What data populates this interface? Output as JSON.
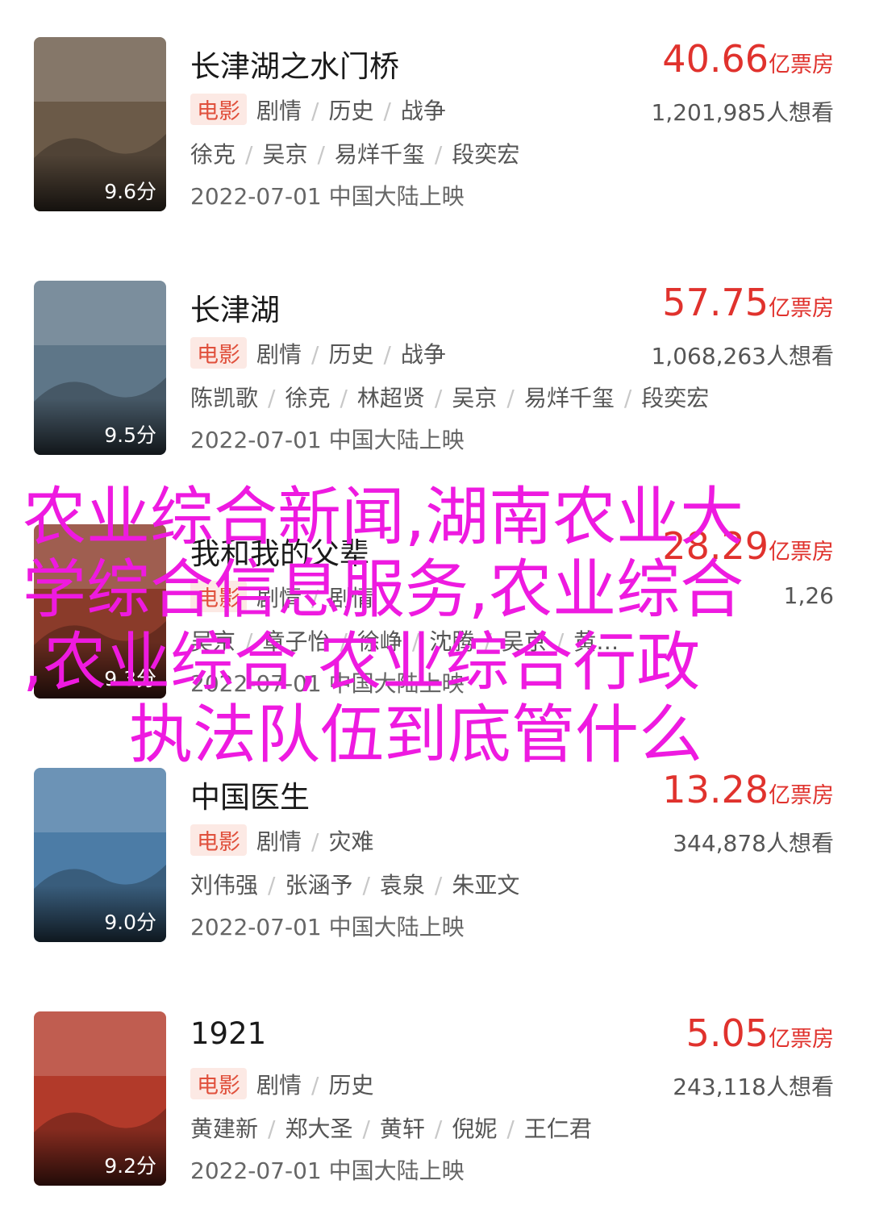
{
  "movies": [
    {
      "title": "长津湖之水门桥",
      "score": "9.6分",
      "box_office": "40.66",
      "box_unit": "亿票房",
      "tag": "电影",
      "genres": [
        "剧情",
        "历史",
        "战争"
      ],
      "want": "1,201,985人想看",
      "cast": [
        "徐克",
        "吴京",
        "易烊千玺",
        "段奕宏"
      ],
      "release": "2022-07-01 中国大陆上映",
      "poster_color": "#6b5a48"
    },
    {
      "title": "长津湖",
      "score": "9.5分",
      "box_office": "57.75",
      "box_unit": "亿票房",
      "tag": "电影",
      "genres": [
        "剧情",
        "历史",
        "战争"
      ],
      "want": "1,068,263人想看",
      "cast": [
        "陈凯歌",
        "徐克",
        "林超贤",
        "吴京",
        "易烊千玺",
        "段奕宏"
      ],
      "release": "2022-07-01 中国大陆上映",
      "poster_color": "#5e7688"
    },
    {
      "title": "我和我的父辈",
      "score": "9.3分",
      "box_office": "28.29",
      "box_unit": "亿票房",
      "tag": "电影",
      "genres": [
        "剧情",
        "剧情"
      ],
      "want": "1,26",
      "cast": [
        "吴京",
        "章子怡",
        "徐峥",
        "沈腾",
        "吴京",
        "黄…"
      ],
      "release": "2022-07-01 中国大陆上映",
      "poster_color": "#8a3b2a"
    },
    {
      "title": "中国医生",
      "score": "9.0分",
      "box_office": "13.28",
      "box_unit": "亿票房",
      "tag": "电影",
      "genres": [
        "剧情",
        "灾难"
      ],
      "want": "344,878人想看",
      "cast": [
        "刘伟强",
        "张涵予",
        "袁泉",
        "朱亚文"
      ],
      "release": "2022-07-01 中国大陆上映",
      "poster_color": "#4c7ca6"
    },
    {
      "title": "1921",
      "score": "9.2分",
      "box_office": "5.05",
      "box_unit": "亿票房",
      "tag": "电影",
      "genres": [
        "剧情",
        "历史"
      ],
      "want": "243,118人想看",
      "cast": [
        "黄建新",
        "郑大圣",
        "黄轩",
        "倪妮",
        "王仁君"
      ],
      "release": "2022-07-01 中国大陆上映",
      "poster_color": "#b23a2a"
    }
  ],
  "overlay_text": [
    "农业综合新闻,湖南农业大",
    "学综合信息服务,农业综合",
    ",农业综合,农业综合行政",
    "执法队伍到底管什么"
  ],
  "colors": {
    "accent_red": "#e0322d",
    "overlay_magenta": "#ee1ae0",
    "tag_bg": "#fce9e4"
  }
}
